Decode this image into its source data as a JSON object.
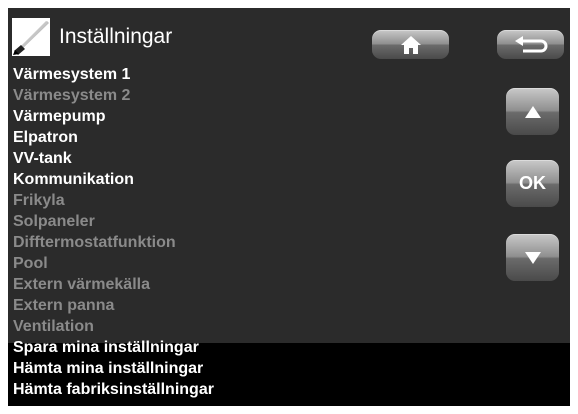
{
  "header": {
    "title": "Inställningar",
    "title_icon": "screwdriver-icon"
  },
  "nav": {
    "home_icon": "home-icon",
    "back_icon": "back-arrow-icon"
  },
  "controls": {
    "up_icon": "arrow-up-icon",
    "ok_label": "OK",
    "down_icon": "arrow-down-icon"
  },
  "menu": {
    "items": [
      {
        "label": "Värmesystem 1",
        "enabled": true
      },
      {
        "label": "Värmesystem 2",
        "enabled": false
      },
      {
        "label": "Värmepump",
        "enabled": true
      },
      {
        "label": "Elpatron",
        "enabled": true
      },
      {
        "label": "VV-tank",
        "enabled": true
      },
      {
        "label": "Kommunikation",
        "enabled": true
      },
      {
        "label": "Frikyla",
        "enabled": false
      },
      {
        "label": "Solpaneler",
        "enabled": false
      },
      {
        "label": "Difftermostatfunktion",
        "enabled": false
      },
      {
        "label": "Pool",
        "enabled": false
      },
      {
        "label": "Extern värmekälla",
        "enabled": false
      },
      {
        "label": "Extern panna",
        "enabled": false
      },
      {
        "label": "Ventilation",
        "enabled": false
      },
      {
        "label": "Spara mina inställningar",
        "enabled": true
      },
      {
        "label": "Hämta mina inställningar",
        "enabled": true
      },
      {
        "label": "Hämta fabriksinställningar",
        "enabled": true
      }
    ]
  },
  "colors": {
    "screen_bg": "#2b2b2b",
    "bottom_band": "#000000",
    "active_text": "#ffffff",
    "inactive_text": "#8a8a8a"
  }
}
